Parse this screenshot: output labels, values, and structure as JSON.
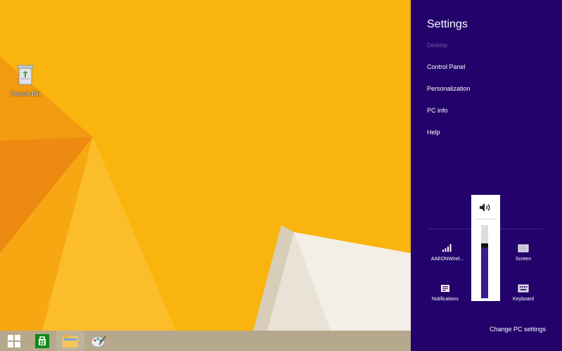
{
  "desktop": {
    "recycle_bin_label": "Recycle Bin"
  },
  "taskbar": {
    "buttons": [
      "start-icon",
      "store-icon",
      "file-explorer-icon",
      "paint-icon"
    ]
  },
  "settings": {
    "title": "Settings",
    "app_name": "Desktop",
    "menu": [
      "Control Panel",
      "Personalization",
      "PC info",
      "Help"
    ],
    "tiles": {
      "network": "AAEONWirel...",
      "screen": "Screen",
      "notifications": "Notifications",
      "keyboard": "Keyboard"
    },
    "change_pc_settings": "Change PC settings",
    "volume_level": 0.72,
    "accent_color": "#23036b"
  }
}
